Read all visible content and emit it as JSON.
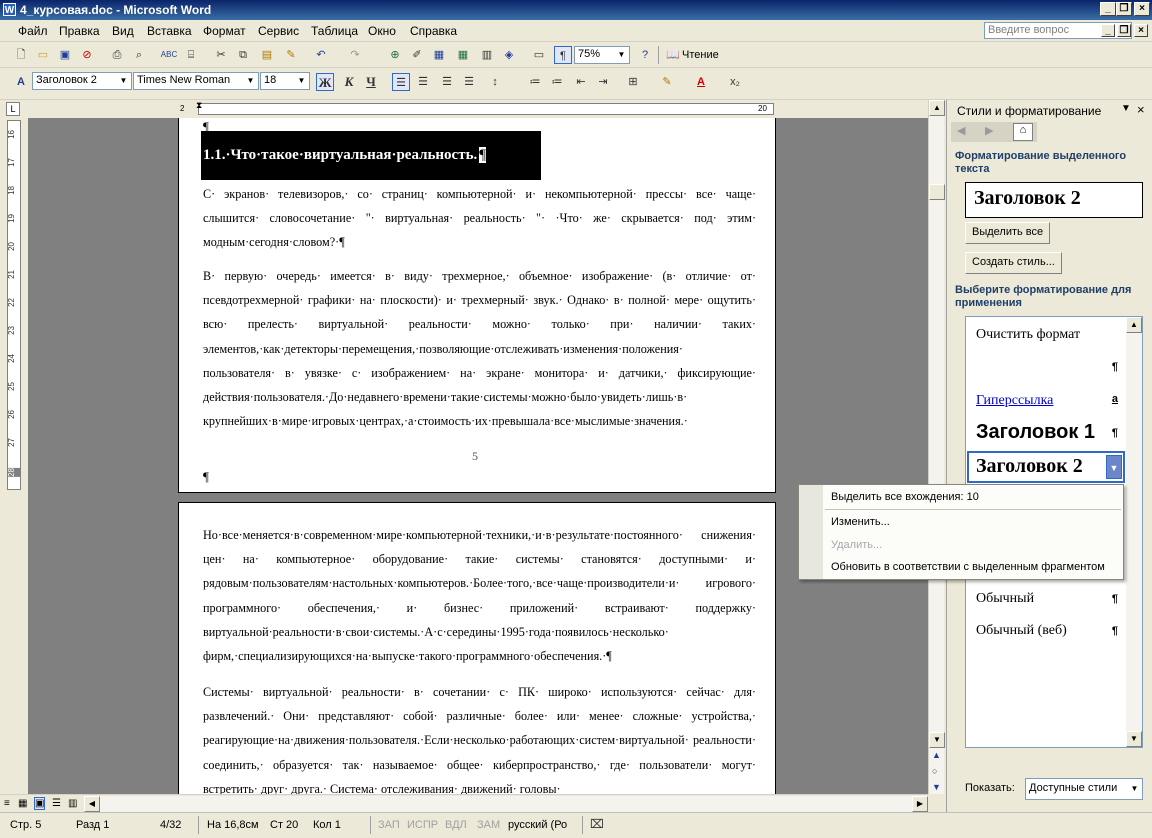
{
  "window": {
    "title": "4_курсовая.doc - Microsoft Word",
    "app_icon": "W"
  },
  "menu": {
    "items": [
      "Файл",
      "Правка",
      "Вид",
      "Вставка",
      "Формат",
      "Сервис",
      "Таблица",
      "Окно",
      "Справка"
    ],
    "ask_placeholder": "Введите вопрос"
  },
  "toolbar": {
    "zoom": "75%",
    "reading_label": "Чтение"
  },
  "format_toolbar": {
    "style": "Заголовок 2",
    "font": "Times New Roman",
    "size": "18",
    "bold": "Ж",
    "italic": "К",
    "underline": "Ч"
  },
  "ruler": {
    "left_num": "2",
    "right_num": "20"
  },
  "vruler": {
    "numbers": [
      "16",
      "17",
      "18",
      "19",
      "20",
      "21",
      "22",
      "23",
      "24",
      "25",
      "26",
      "27",
      "28"
    ]
  },
  "document": {
    "pilcrow": "¶",
    "heading": "1.1.·Что·такое·виртуальная·реальность.",
    "para1": "С· экранов· телевизоров,· со· страниц· компьютерной· и· некомпьютерной· прессы· все· чаще· слышится· словосочетание· \"· виртуальная· реальность· \"· ·Что· же· скрывается· под· этим· модным·сегодня·словом?·¶",
    "para2": "В· первую· очередь· имеется· в· виду· трехмерное,· объемное· изображение· (в· отличие· от· псевдотрехмерной· графики· на· плоскости)· и· трехмерный· звук.· Однако· в· полной· мере· ощутить· всю· прелесть· виртуальной· реальности· можно· только· при· наличии· таких· элементов,·как·детекторы·перемещения,·позволяющие·отслеживать·изменения·положения· пользователя· в· увязке· с· изображением· на· экране· монитора· и· датчики,· фиксирующие· действия·пользователя.·До·недавнего·времени·такие·системы·можно·было·увидеть·лишь·в· крупнейших·в·мире·игровых·центрах,·а·стоимость·их·превышала·все·мыслимые·значения.·",
    "page_number": "5",
    "para3": "Но·все·меняется·в·современном·мире·компьютерной·техники,·и·в·результате·постоянного· снижения· цен· на· компьютерное· оборудование· такие· системы· становятся· доступными· и· рядовым·пользователям·настольных·компьютеров.·Более·того,·все·чаще·производители·и· игрового· программного· обеспечения,· и· бизнес· приложений· встраивают· поддержку· виртуальной·реальности·в·свои·системы.·А·с·середины·1995·года·появилось·несколько· фирм,·специализирующихся·на·выпуске·такого·программного·обеспечения.·¶",
    "para4": "Системы· виртуальной· реальности· в· сочетании· с· ПК· широко· используются· сейчас· для· развлечений.· Они· представляют· собой· различные· более· или· менее· сложные· устройства,· реагирующие·на·движения·пользователя.·Если·несколько·работающих·систем·виртуальной· реальности· соединить,· образуется· так· называемое· общее· киберпространство,· где· пользователи· могут· встретить· друг· друга.· Система· отслеживания· движений· головы·"
  },
  "taskpane": {
    "title": "Стили и форматирование",
    "section1": "Форматирование выделенного текста",
    "current_style": "Заголовок 2",
    "select_all": "Выделить все",
    "new_style": "Создать стиль...",
    "section2": "Выберите форматирование для применения",
    "styles": [
      "Очистить формат",
      "Гиперссылка",
      "Заголовок 1",
      "Заголовок 2",
      "Обычный",
      "Обычный (веб)"
    ],
    "pmarks": [
      "¶",
      "a",
      "¶",
      "¶",
      "¶"
    ],
    "show_label": "Показать:",
    "show_value": "Доступные стили"
  },
  "context_menu": {
    "items": [
      "Выделить все вхождения: 10",
      "Изменить...",
      "Удалить...",
      "Обновить в соответствии с выделенным фрагментом"
    ]
  },
  "status": {
    "page": "Стр. 5",
    "section": "Разд 1",
    "pages": "4/32",
    "position": "На 16,8см",
    "line": "Ст 20",
    "col": "Кол 1",
    "rec": "ЗАП",
    "trk": "ИСПР",
    "ext": "ВДЛ",
    "ovr": "ЗАМ",
    "language": "русский (Ро"
  }
}
